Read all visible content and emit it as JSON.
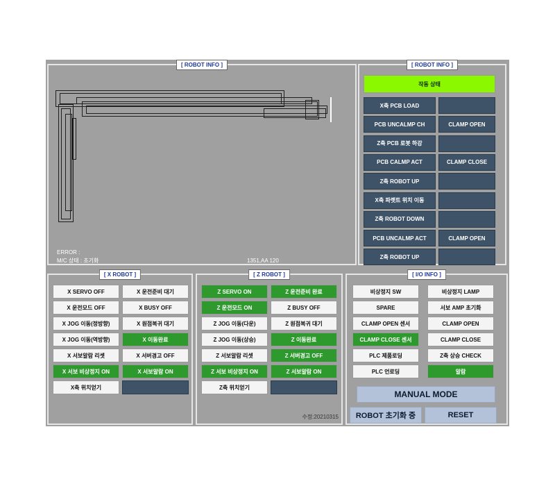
{
  "robot_info_main": {
    "title": "[ ROBOT INFO ]",
    "error_label": "ERROR :",
    "mc_state": "M/C 상태 : 초기화",
    "coords": "1351,AA 120"
  },
  "robot_info_side": {
    "title": "[ ROBOT INFO ]",
    "status_header": "작동 상태",
    "rows": [
      {
        "step": "X축 PCB LOAD",
        "state": ""
      },
      {
        "step": "PCB UNCALMP CH",
        "state": "CLAMP OPEN"
      },
      {
        "step": "Z축 PCB 로봇 하강",
        "state": ""
      },
      {
        "step": "PCB CALMP ACT",
        "state": "CLAMP CLOSE"
      },
      {
        "step": "Z축 ROBOT UP",
        "state": ""
      },
      {
        "step": "X축 파렛트 위치 이동",
        "state": ""
      },
      {
        "step": "Z축 ROBOT DOWN",
        "state": ""
      },
      {
        "step": "PCB UNCALMP ACT",
        "state": "CLAMP OPEN"
      },
      {
        "step": "Z축 ROBOT UP",
        "state": ""
      }
    ]
  },
  "x_robot": {
    "title": "[ X ROBOT ]",
    "left": [
      "X SERVO OFF",
      "X 운전모드 OFF",
      "X JOG 이동(정방향)",
      "X JOG 이동(역방향)",
      "X 서보알람 리셋",
      "X 서보 비상정지 ON",
      "X축 위치얻기"
    ],
    "right": [
      "X 운전준비 대기",
      "X BUSY OFF",
      "X 원점복귀 대기",
      "X 이동완료",
      "X 서버경고 OFF",
      "X 서보알람 ON",
      ""
    ]
  },
  "z_robot": {
    "title": "[ Z ROBOT ]",
    "left": [
      "Z SERVO ON",
      "Z 운전모드 ON",
      "Z JOG 이동(다운)",
      "Z JOG 이동(상승)",
      "Z 서보알람 리셋",
      "Z 서보 비상정지 ON",
      "Z축 위치얻기"
    ],
    "right": [
      "Z 운전준비 완료",
      "Z BUSY OFF",
      "Z 원점복귀 대기",
      "Z 이동완료",
      "Z 서버경고 OFF",
      "Z 서보알람 ON",
      ""
    ],
    "version": "수정:20210315"
  },
  "io_info": {
    "title": "[ I/O INFO ]",
    "left": [
      "비상정지 SW",
      "SPARE",
      "CLAMP OPEN 센서",
      "CLAMP CLOSE 센서",
      "PLC 제품로딩",
      "PLC 언로딩"
    ],
    "right": [
      "비상정지 LAMP",
      "서보 AMP 초기화",
      "CLAMP OPEN",
      "CLAMP CLOSE",
      "Z축 상승 CHECK",
      "알람"
    ],
    "manual_mode": "MANUAL MODE",
    "robot_init": "ROBOT 초기화 중",
    "reset": "RESET"
  },
  "colors": {
    "active": "#2e9a2e",
    "idle": "#f4f4f4",
    "empty": "#3e5368",
    "highlight": "#8cf800"
  }
}
